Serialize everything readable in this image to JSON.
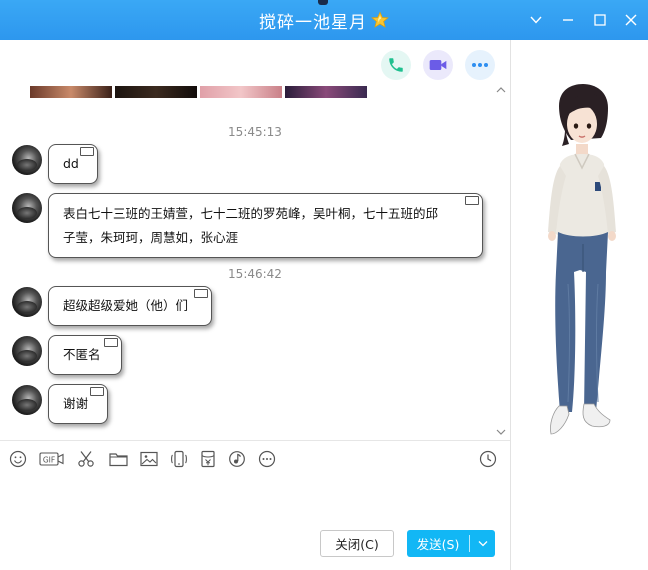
{
  "window": {
    "title": "搅碎一池星月",
    "accent_color": "#2d97ee"
  },
  "header_actions": {
    "phone": "phone-icon",
    "video": "video-camera-icon",
    "more": "more-icon"
  },
  "messages": [
    {
      "type": "time",
      "text": "15:45:13"
    },
    {
      "type": "msg",
      "text": "dd"
    },
    {
      "type": "msg",
      "lines": [
        "表白七十三班的王婧萱，七十二班的罗苑峰，吴叶桐，七十五班的邱",
        "子莹，朱珂珂，周慧如，张心涯"
      ]
    },
    {
      "type": "time",
      "text": "15:46:42"
    },
    {
      "type": "msg",
      "text": "超级超级爱她（他）们"
    },
    {
      "type": "msg",
      "text": "不匿名"
    },
    {
      "type": "msg",
      "text": "谢谢"
    }
  ],
  "toolbar": {
    "gif_label": "GIF",
    "icons": [
      "emoji-icon",
      "gif-icon",
      "scissors-icon",
      "folder-icon",
      "image-icon",
      "screen-shake-icon",
      "red-packet-icon",
      "music-icon",
      "more-icon",
      "history-clock-icon"
    ]
  },
  "buttons": {
    "close_label": "关闭(C)",
    "send_label": "发送(S)"
  }
}
